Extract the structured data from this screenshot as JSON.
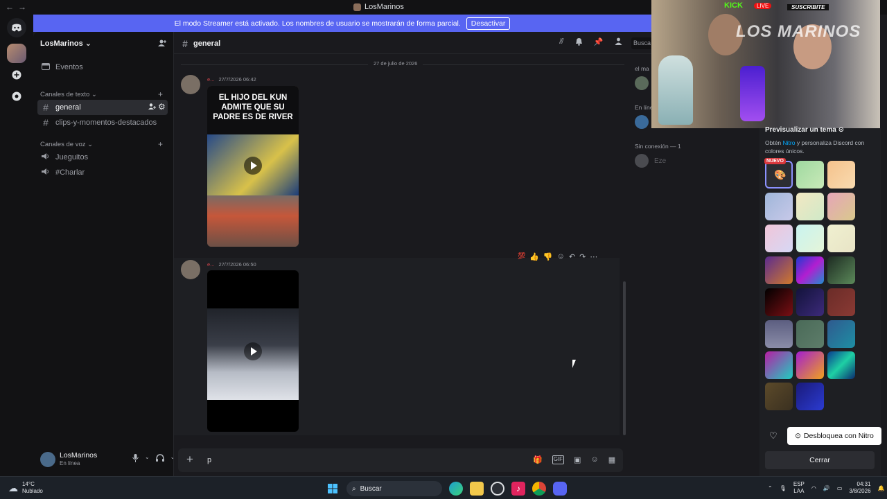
{
  "window": {
    "title": "LosMarinos",
    "nav_back": "←",
    "nav_forward": "→"
  },
  "streamer_banner": {
    "text": "El modo Streamer está activado. Los nombres de usuario se mostrarán de forma parcial.",
    "button": "Desactivar"
  },
  "server": {
    "name": "LosMarinos ⌄"
  },
  "sidebar": {
    "events": "Eventos",
    "text_category": "Canales de texto ⌄",
    "text_channels": [
      "general",
      "clips-y-momentos-destacados"
    ],
    "voice_category": "Canales de voz ⌄",
    "voice_channels": [
      "Jueguitos",
      "#Charlar"
    ]
  },
  "user": {
    "name": "LosMarinos",
    "status": "En línea"
  },
  "channel": {
    "name": "general",
    "search_placeholder": "Busca"
  },
  "messages": {
    "date_divider": "27 de julio de 2026",
    "items": [
      {
        "author": "e...",
        "time": "27/7/2026 06:42",
        "caption": "EL HIJO DEL KUN ADMITE QUE SU PADRE ES DE RIVER"
      },
      {
        "author": "e...",
        "time": "27/7/2026 06:50",
        "caption": ""
      }
    ]
  },
  "composer": {
    "typed": "p"
  },
  "members": {
    "group1": "el ma",
    "online": "En línea",
    "offline": "Sin conexión — 1",
    "offline_user": "Eze"
  },
  "webcam": {
    "brand": "KICK",
    "live": "LIVE",
    "subscribe": "SUSCRIBITE",
    "logo": "LOS MARINOS"
  },
  "theme_panel": {
    "title": "Previsualizar un tema",
    "desc_pre": "Obtén ",
    "desc_nitro": "Nitro",
    "desc_post": " y personaliza Discord con colores únicos.",
    "new_badge": "NUEVO",
    "unlock": "Desbloquea con Nitro",
    "close": "Cerrar"
  },
  "taskbar": {
    "temp": "14°C",
    "weather": "Nublado",
    "search": "Buscar",
    "lang": "ESP",
    "region": "LAA",
    "time": "04:31",
    "date": "3/8/2026"
  }
}
